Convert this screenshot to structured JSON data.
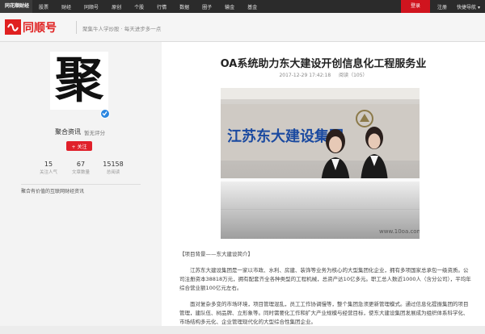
{
  "topnav": {
    "brand": "同花顺财经",
    "links": [
      "股票",
      "财经",
      "同顺号",
      "原创",
      "个股",
      "行情",
      "数据",
      "圈子",
      "输金",
      "基金"
    ],
    "login": "登录",
    "register": "注册",
    "quick_nav": "快捷导航"
  },
  "header": {
    "logo_text": "同顺号",
    "slogan": "聚集牛人学炒股 · 每天进步多一点"
  },
  "author": {
    "avatar_char": "聚",
    "name": "聚合资讯",
    "level": "暂无评分",
    "follow": "+ 关注",
    "stats": [
      {
        "value": "15",
        "label": "关注人气"
      },
      {
        "value": "67",
        "label": "文章数量"
      },
      {
        "value": "15158",
        "label": "总阅读"
      }
    ],
    "bio": "聚合有价值的互联网财经资讯"
  },
  "article": {
    "title": "OA系统助力东大建设开创信息化工程服务业",
    "time": "2017-12-29 17:42:18",
    "reads": "阅读（105）",
    "image_sign": "江苏东大建设集团",
    "watermark": "www.10oa.com",
    "paragraphs": [
      "【项目背景——东大建设简介】",
      "江苏东大建设集团是一家以市政、水利、房建、装饰等业务为核心的大型集团化企业，拥有多项国家总承包一级资质。公司注册资本38818万元，拥有配套齐全各种类型的工程机械，总资产达10亿多元。职工总人数近1000人（含分公司），平均年综合营业额100亿元左右。",
      "面对复杂多变的市场环境，项目管理混乱，员工工作协调慢等，整个集团急须更新管理模式。通过信息化提振集团的项目管理，建队伍、树品牌、立形象等。同时需要化工作和扩大产业规模与经营目标，使东大建设集团发展成为组织体系科学化、市场结构多元化、企业管理现代化的大型综合性集团企业。"
    ]
  },
  "colors": {
    "brand_red": "#e02020",
    "nav_dark": "#2b2b2b",
    "verify_blue": "#2a86e0"
  }
}
